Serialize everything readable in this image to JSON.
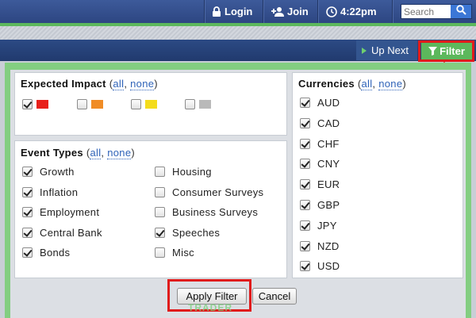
{
  "nav": {
    "login": "Login",
    "join": "Join",
    "time": "4:22pm",
    "search_placeholder": "Search",
    "icons": [
      "lock-icon",
      "add-user-icon",
      "clock-icon",
      "search-icon"
    ]
  },
  "toolbar": {
    "up_next": "Up Next",
    "filter": "Filter"
  },
  "impact": {
    "title": "Expected Impact",
    "all": "all",
    "none": "none",
    "levels": [
      {
        "color": "#e8201a",
        "checked": true
      },
      {
        "color": "#f08c26",
        "checked": false
      },
      {
        "color": "#f4dc1c",
        "checked": false
      },
      {
        "color": "#b9b9b9",
        "checked": false
      }
    ]
  },
  "event_types": {
    "title": "Event Types",
    "all": "all",
    "none": "none",
    "items": [
      {
        "label": "Growth",
        "checked": true
      },
      {
        "label": "Inflation",
        "checked": true
      },
      {
        "label": "Employment",
        "checked": true
      },
      {
        "label": "Central Bank",
        "checked": true
      },
      {
        "label": "Bonds",
        "checked": true
      },
      {
        "label": "Housing",
        "checked": false
      },
      {
        "label": "Consumer Surveys",
        "checked": false
      },
      {
        "label": "Business Surveys",
        "checked": false
      },
      {
        "label": "Speeches",
        "checked": true
      },
      {
        "label": "Misc",
        "checked": false
      }
    ]
  },
  "currencies": {
    "title": "Currencies",
    "all": "all",
    "none": "none",
    "items": [
      {
        "label": "AUD",
        "checked": true
      },
      {
        "label": "CAD",
        "checked": true
      },
      {
        "label": "CHF",
        "checked": true
      },
      {
        "label": "CNY",
        "checked": true
      },
      {
        "label": "EUR",
        "checked": true
      },
      {
        "label": "GBP",
        "checked": true
      },
      {
        "label": "JPY",
        "checked": true
      },
      {
        "label": "NZD",
        "checked": true
      },
      {
        "label": "USD",
        "checked": true
      }
    ]
  },
  "actions": {
    "apply": "Apply Filter",
    "cancel": "Cancel"
  },
  "watermark": "TRADER",
  "colors": {
    "accent_green": "#5cb85c",
    "nav_blue": "#2d4682",
    "highlight_red": "#e01b1b",
    "link_blue": "#2f63b8"
  }
}
